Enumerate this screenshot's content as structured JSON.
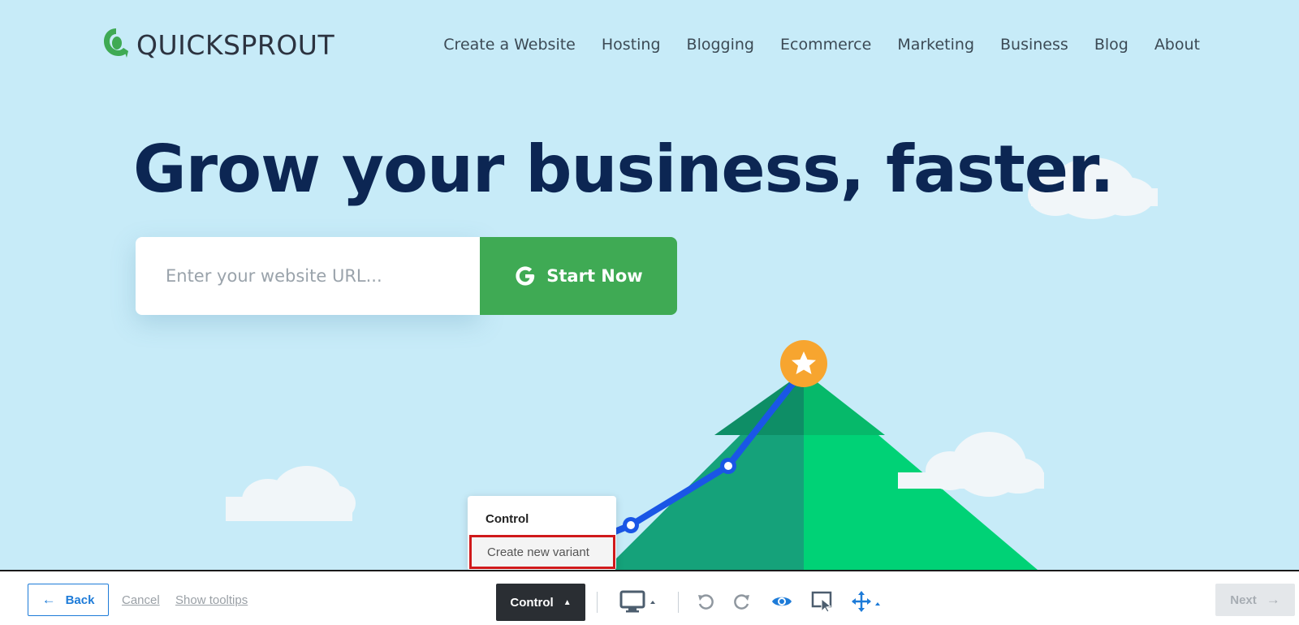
{
  "brand": {
    "name": "QUICKSPROUT",
    "accent": "#3faa54",
    "headline_color": "#0c2653"
  },
  "nav": {
    "items": [
      "Create a Website",
      "Hosting",
      "Blogging",
      "Ecommerce",
      "Marketing",
      "Business",
      "Blog",
      "About"
    ]
  },
  "hero": {
    "headline": "Grow your business, faster.",
    "url_placeholder": "Enter your website URL...",
    "start_label": "Start Now"
  },
  "dropdown": {
    "current": "Control",
    "create_label": "Create new variant"
  },
  "toolbar": {
    "back_label": "Back",
    "cancel_label": "Cancel",
    "tooltips_label": "Show tooltips",
    "variant_label": "Control",
    "next_label": "Next",
    "icons": [
      "desktop-icon",
      "undo-icon",
      "redo-icon",
      "preview-eye-icon",
      "select-cursor-icon",
      "move-arrows-icon"
    ]
  }
}
